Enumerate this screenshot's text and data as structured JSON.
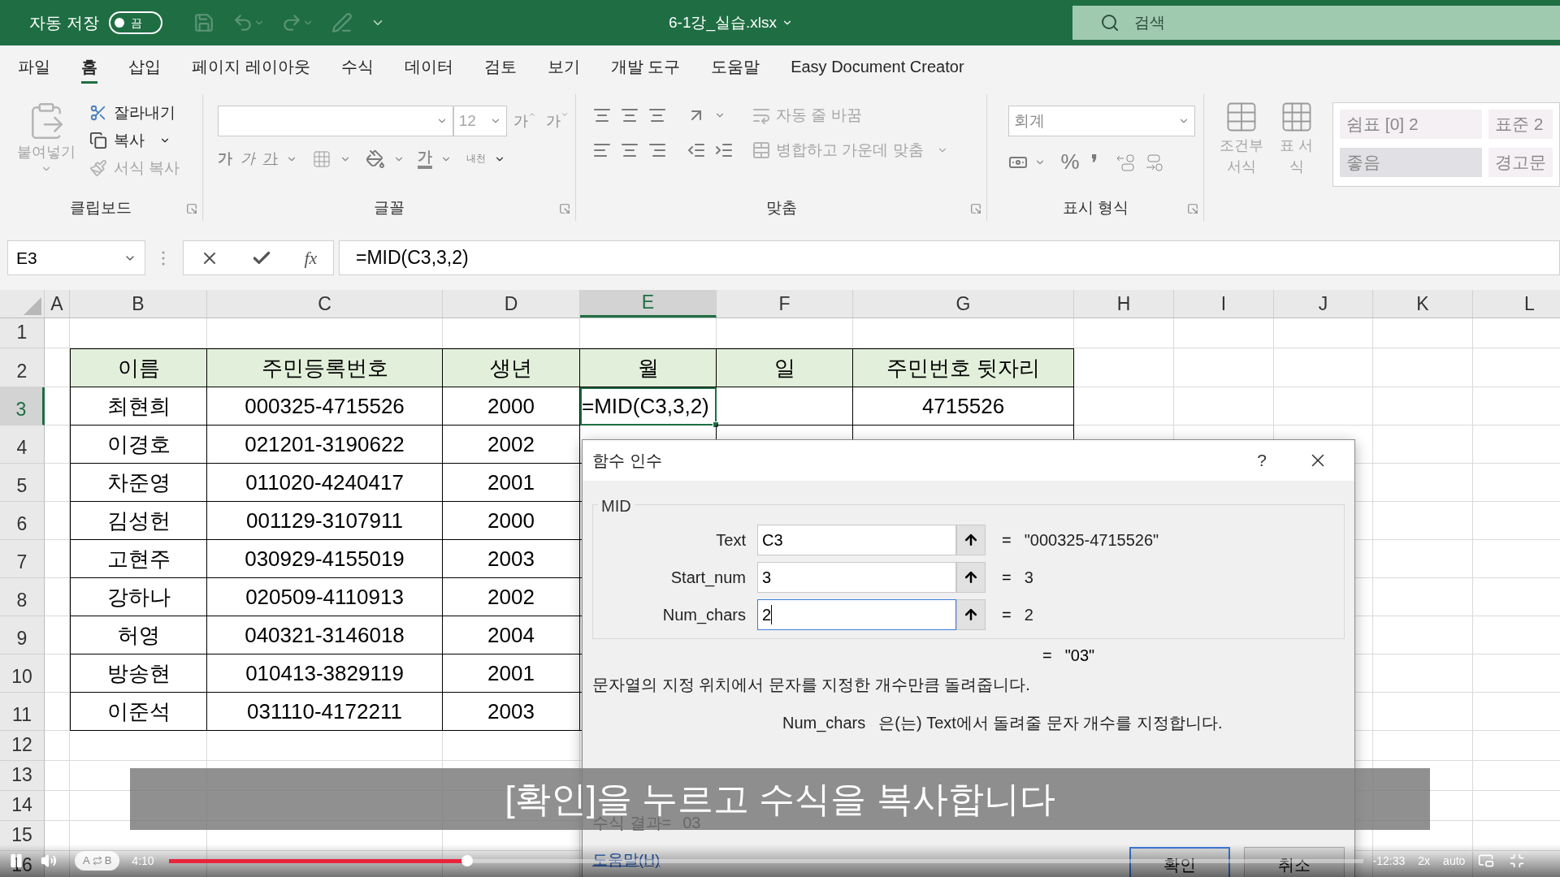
{
  "title_bar": {
    "autosave": {
      "label": "자동 저장",
      "toggle_text": "끔",
      "on": false
    },
    "file_name": "6-1강_실습.xlsx",
    "search": {
      "placeholder": "검색"
    }
  },
  "ribbon_tabs": [
    {
      "label": "파일",
      "selected": false
    },
    {
      "label": "홈",
      "selected": true
    },
    {
      "label": "삽입",
      "selected": false
    },
    {
      "label": "페이지 레이아웃",
      "selected": false
    },
    {
      "label": "수식",
      "selected": false
    },
    {
      "label": "데이터",
      "selected": false
    },
    {
      "label": "검토",
      "selected": false
    },
    {
      "label": "보기",
      "selected": false
    },
    {
      "label": "개발 도구",
      "selected": false
    },
    {
      "label": "도움말",
      "selected": false
    },
    {
      "label": "Easy Document Creator",
      "selected": false
    }
  ],
  "ribbon": {
    "clipboard": {
      "title": "클립보드",
      "paste": {
        "label": "붙여넣기",
        "disabled": true
      },
      "cut": {
        "label": "잘라내기",
        "disabled": false
      },
      "copy": {
        "label": "복사",
        "disabled": false
      },
      "format_painter": {
        "label": "서식 복사",
        "disabled": true
      }
    },
    "font": {
      "title": "글꼴",
      "size": "12",
      "grow": "가",
      "shrink": "가",
      "bold": "가",
      "italic": "가",
      "underline": "가",
      "font_color": "가",
      "phonetic": "내천"
    },
    "alignment": {
      "title": "맞춤",
      "wrap_text": {
        "label": "자동 줄 바꿈",
        "disabled": true
      },
      "merge": {
        "label": "병합하고 가운데 맞춤",
        "disabled": true
      }
    },
    "number": {
      "title": "표시 형식",
      "format": "회계",
      "percent": "%",
      "comma": "❜"
    },
    "styles": {
      "conditional": {
        "label": "조건부 서식",
        "disabled": true
      },
      "table": {
        "label": "표 서식",
        "disabled": true
      },
      "gallery": [
        {
          "label": "쉼표 [0] 2",
          "color": "#f4f0f4"
        },
        {
          "label": "표준 2",
          "color": "#f4f0f4"
        },
        {
          "label": "좋음",
          "color": "#e1e0e4"
        },
        {
          "label": "경고문",
          "color": "#f4f0f4"
        }
      ]
    }
  },
  "formula_bar": {
    "name_box": "E3",
    "function_button": "fx",
    "formula": "=MID(C3,3,2)"
  },
  "sheet": {
    "columns": [
      {
        "label": "A",
        "selected": false
      },
      {
        "label": "B",
        "selected": false
      },
      {
        "label": "C",
        "selected": false
      },
      {
        "label": "D",
        "selected": false
      },
      {
        "label": "E",
        "selected": true
      },
      {
        "label": "F",
        "selected": false
      },
      {
        "label": "G",
        "selected": false
      },
      {
        "label": "H",
        "selected": false
      },
      {
        "label": "I",
        "selected": false
      },
      {
        "label": "J",
        "selected": false
      },
      {
        "label": "K",
        "selected": false
      },
      {
        "label": "L",
        "selected": false
      }
    ],
    "rows": [
      {
        "label": "1",
        "selected": false
      },
      {
        "label": "2",
        "selected": false
      },
      {
        "label": "3",
        "selected": true
      },
      {
        "label": "4",
        "selected": false
      },
      {
        "label": "5",
        "selected": false
      },
      {
        "label": "6",
        "selected": false
      },
      {
        "label": "7",
        "selected": false
      },
      {
        "label": "8",
        "selected": false
      },
      {
        "label": "9",
        "selected": false
      },
      {
        "label": "10",
        "selected": false
      },
      {
        "label": "11",
        "selected": false
      },
      {
        "label": "12",
        "selected": false
      },
      {
        "label": "13",
        "selected": false
      },
      {
        "label": "14",
        "selected": false
      },
      {
        "label": "15",
        "selected": false
      },
      {
        "label": "16",
        "selected": false
      }
    ]
  },
  "table": {
    "headers": [
      "이름",
      "주민등록번호",
      "생년",
      "월",
      "일",
      "주민번호 뒷자리"
    ],
    "rows": [
      {
        "name": "최현희",
        "id_number": "000325-4715526",
        "year": "2000",
        "month": "=MID(C3,3,2)",
        "back_digits": "4715526"
      },
      {
        "name": "이경호",
        "id_number": "021201-3190622",
        "year": "2002"
      },
      {
        "name": "차준영",
        "id_number": "011020-4240417",
        "year": "2001"
      },
      {
        "name": "김성헌",
        "id_number": "001129-3107911",
        "year": "2000"
      },
      {
        "name": "고현주",
        "id_number": "030929-4155019",
        "year": "2003"
      },
      {
        "name": "강하나",
        "id_number": "020509-4110913",
        "year": "2002"
      },
      {
        "name": "허영",
        "id_number": "040321-3146018",
        "year": "2004"
      },
      {
        "name": "방송현",
        "id_number": "010413-3829119",
        "year": "2001"
      },
      {
        "name": "이준석",
        "id_number": "031110-4172211",
        "year": "2003"
      }
    ]
  },
  "dialog": {
    "title": "함수 인수",
    "help": "?",
    "function_name": "MID",
    "arguments": [
      {
        "label": "Text",
        "value": "C3",
        "equals": "=",
        "result": "\"000325-4715526\"",
        "focused": false
      },
      {
        "label": "Start_num",
        "value": "3",
        "equals": "=",
        "result": "3",
        "focused": false
      },
      {
        "label": "Num_chars",
        "value": "2",
        "equals": "=",
        "result": "2",
        "focused": true
      }
    ],
    "result": {
      "equals": "=",
      "value": "\"03\""
    },
    "description": "문자열의 지정 위치에서 문자를 지정한 개수만큼 돌려줍니다.",
    "argument_help": {
      "name": "Num_chars",
      "text": "은(는) Text에서 돌려줄 문자 개수를 지정합니다."
    },
    "formula_result": {
      "label": "수식 결과=",
      "value": "03"
    },
    "help_link": "도움말(H)",
    "buttons": [
      {
        "label": "확인",
        "default": true
      },
      {
        "label": "취소",
        "default": false
      }
    ]
  },
  "subtitle": "[확인]을 누르고 수식을 복사합니다",
  "player": {
    "playing": true,
    "ab_loop": {
      "a": "A",
      "b": "B"
    },
    "elapsed": "4:10",
    "level": 0.25,
    "remaining": "-12:33",
    "speed": "2x",
    "quality": "auto"
  }
}
